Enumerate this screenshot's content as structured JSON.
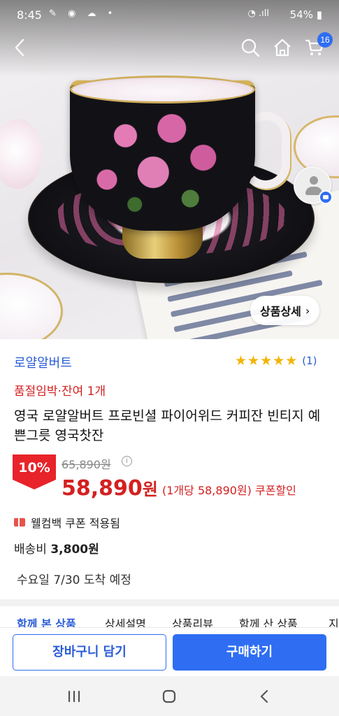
{
  "status_bar": {
    "time": "8:45",
    "battery": "54%"
  },
  "app_bar": {
    "cart_badge": "16"
  },
  "hero": {
    "detail_button_label": "상품상세",
    "detail_button_chevron": "›"
  },
  "product": {
    "brand": "로얄알버트",
    "rating_stars": 5,
    "review_count": "(1)",
    "stock_notice": "품절임박·잔여 1개",
    "title": "영국 로얄알버트 프로빈셜 파이어위드 커피잔 빈티지 예쁜그릇 영국찻잔",
    "discount": "10%",
    "original_price": "65,890원",
    "price": "58,890",
    "price_unit": "원",
    "price_note": "(1개당 58,890원) 쿠폰할인",
    "coupon": "웰컴백 쿠폰 적용됨",
    "shipping_label": "배송비",
    "shipping_fee": "3,800원",
    "delivery": "수요일 7/30 도착 예정"
  },
  "tabs": [
    {
      "label": "함께 본 상품",
      "active": true
    },
    {
      "label": "상세설명",
      "active": false
    },
    {
      "label": "상품리뷰",
      "active": false
    },
    {
      "label": "함께 산 상품",
      "active": false
    },
    {
      "label": "지",
      "active": false
    }
  ],
  "actions": {
    "add_to_cart": "장바구니 담기",
    "buy": "구매하기"
  },
  "colors": {
    "accent": "#2f6ef2",
    "sale": "#d42020",
    "brand_link": "#2a5cd6"
  }
}
